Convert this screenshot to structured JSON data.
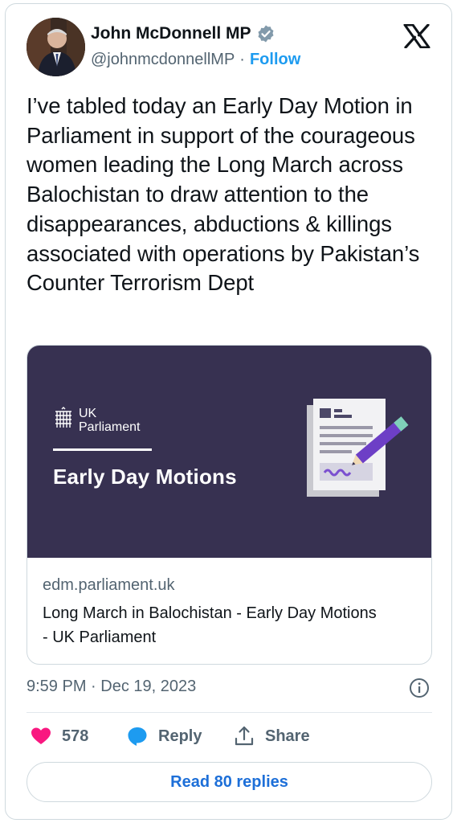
{
  "author": {
    "name": "John McDonnell MP",
    "handle": "@johnmcdonnellMP",
    "separator": "·",
    "follow_label": "Follow"
  },
  "tweet": {
    "text": "I’ve tabled today an Early Day Motion in Parliament in support of the courageous women leading the Long March across Balochistan to draw attention to the disappearances, abductions & killings associated with operations by Pakistan’s Counter Terrorism Dept",
    "timestamp": "9:59 PM · Dec 19, 2023"
  },
  "link_card": {
    "banner_org_line1": "UK",
    "banner_org_line2": "Parliament",
    "banner_title": "Early Day Motions",
    "domain": "edm.parliament.uk",
    "title": "Long March in Balochistan - Early Day Motions - UK Parliament"
  },
  "actions": {
    "like_count": "578",
    "reply_label": "Reply",
    "share_label": "Share"
  },
  "read_replies_label": "Read 80 replies",
  "colors": {
    "accent": "#1d9bf0",
    "like": "#f91880",
    "banner_bg": "#373151",
    "muted": "#536471"
  }
}
